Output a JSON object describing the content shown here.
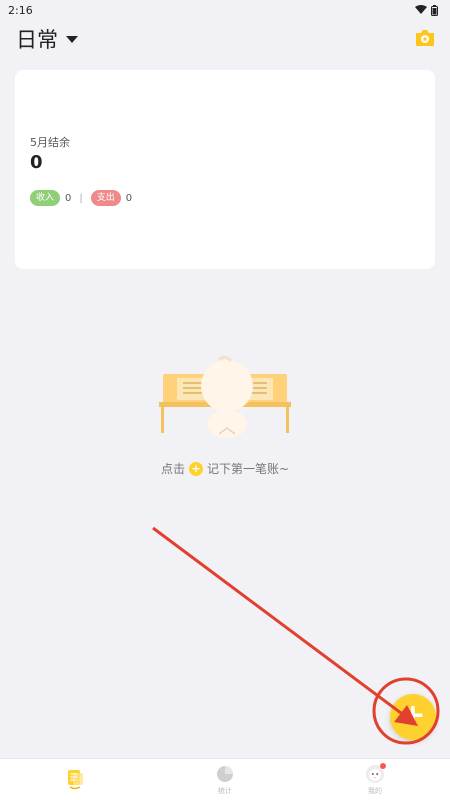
{
  "status_bar": {
    "time": "2:16"
  },
  "header": {
    "book_name": "日常"
  },
  "summary": {
    "month_label": "5月结余",
    "balance": "0",
    "income_label": "收入",
    "income_value": "0",
    "separator": "|",
    "expense_label": "支出",
    "expense_value": "0"
  },
  "empty_state": {
    "hint_before": "点击",
    "hint_plus": "+",
    "hint_after": "记下第一笔账~"
  },
  "fab": {
    "label": "+"
  },
  "tabs": [
    {
      "label": "",
      "icon": "ledger-icon",
      "active": true
    },
    {
      "label": "统计",
      "icon": "pie-chart-icon",
      "active": false
    },
    {
      "label": "我的",
      "icon": "avatar-icon",
      "active": false,
      "has_dot": true
    }
  ],
  "colors": {
    "accent": "#ffd12f",
    "income": "#8fcf78",
    "expense": "#f08a8a",
    "annotation": "#e2402e",
    "background": "#f2f1f6"
  }
}
